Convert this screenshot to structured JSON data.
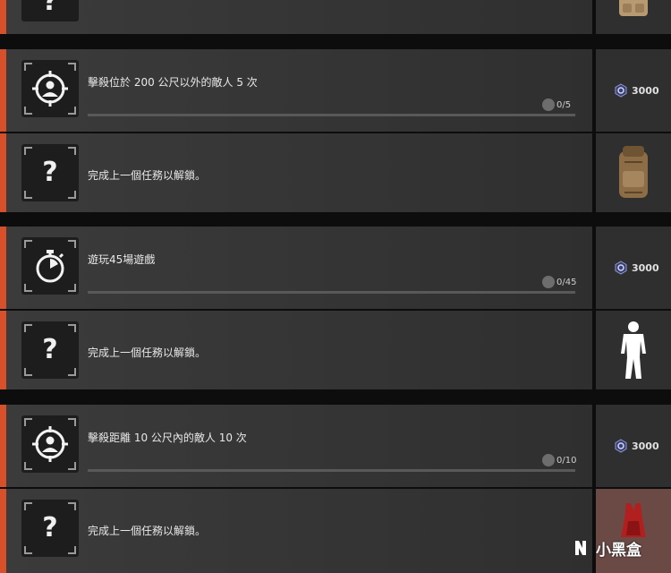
{
  "tasks": [
    {
      "kind": "active",
      "title": "擊殺位於 200 公尺以外的敵人 5 次",
      "progress_text": "0/5",
      "progress": 0,
      "icon": "crosshair-person-icon",
      "reward": {
        "type": "currency",
        "amount": "3000",
        "icon": "gcoin-icon"
      }
    },
    {
      "kind": "locked",
      "label": "完成上一個任務以解鎖。",
      "icon": "question-mark-icon",
      "placeholder": "?",
      "reward": {
        "type": "item",
        "icon": "backpack-icon"
      }
    },
    {
      "kind": "active",
      "title": "遊玩45場遊戲",
      "progress_text": "0/45",
      "progress": 0,
      "icon": "stopwatch-icon",
      "reward": {
        "type": "currency",
        "amount": "3000",
        "icon": "gcoin-icon"
      }
    },
    {
      "kind": "locked",
      "label": "完成上一個任務以解鎖。",
      "icon": "question-mark-icon",
      "placeholder": "?",
      "reward": {
        "type": "item",
        "icon": "character-outfit-icon"
      }
    },
    {
      "kind": "active",
      "title": "擊殺距離 10 公尺內的敵人 10 次",
      "progress_text": "0/10",
      "progress": 0,
      "icon": "crosshair-person-icon",
      "reward": {
        "type": "currency",
        "amount": "3000",
        "icon": "gcoin-icon"
      }
    },
    {
      "kind": "locked",
      "label": "完成上一個任務以解鎖。",
      "icon": "question-mark-icon",
      "placeholder": "?",
      "reward": {
        "type": "item",
        "icon": "red-top-icon"
      }
    }
  ],
  "watermark": {
    "text": "小黑盒"
  },
  "colors": {
    "accent": "#d8502a",
    "row_bg": "#363636",
    "tile_bg": "#1d1d1d"
  }
}
